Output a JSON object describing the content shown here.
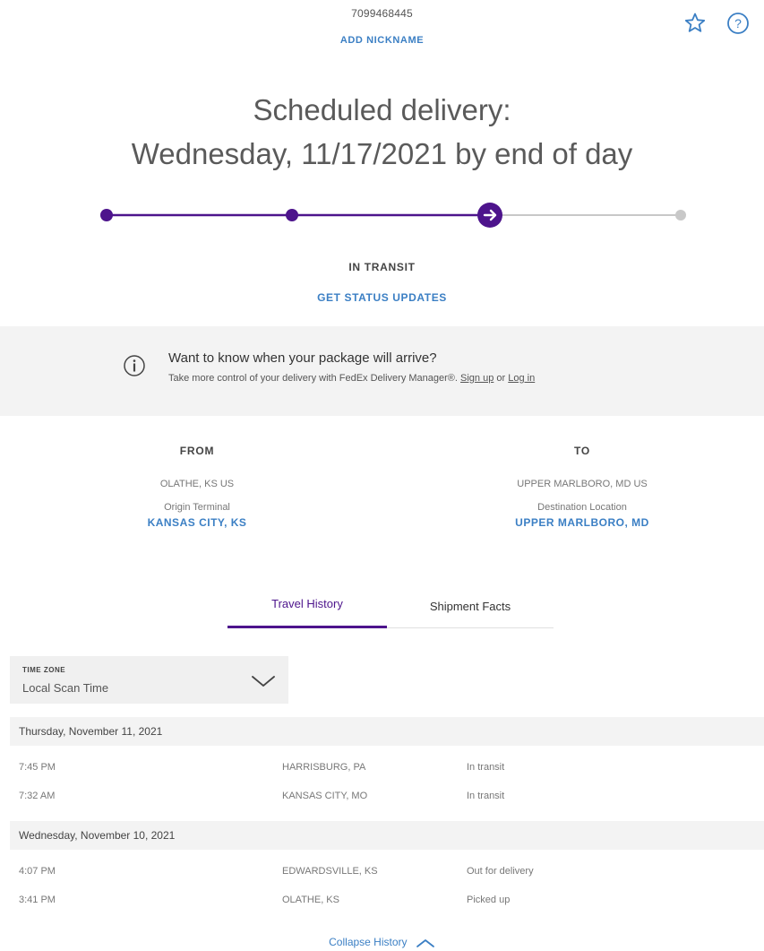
{
  "header": {
    "tracking_number": "7099468445",
    "add_nickname": "ADD NICKNAME",
    "favorite_icon": "star-icon",
    "help_icon": "question-circle-icon"
  },
  "delivery": {
    "line1": "Scheduled delivery:",
    "line2": "Wednesday, 11/17/2021 by end of day"
  },
  "progress": {
    "total_steps": 4,
    "completed_steps": 2,
    "current_step": 3,
    "current_icon": "arrow-right-icon",
    "active_color": "#4d148c",
    "inactive_color": "#c8c8c8"
  },
  "status": {
    "label": "IN TRANSIT",
    "updates_link": "GET STATUS UPDATES"
  },
  "promo": {
    "icon": "info-circle-icon",
    "title": "Want to know when your package will arrive?",
    "subtitle": "Take more control of your delivery with FedEx Delivery Manager®.",
    "signup": "Sign up",
    "or": "or",
    "login": "Log in"
  },
  "from": {
    "heading": "FROM",
    "city": "OLATHE, KS US",
    "location_type": "Origin Terminal",
    "location": "KANSAS CITY, KS"
  },
  "to": {
    "heading": "TO",
    "city": "UPPER MARLBORO, MD US",
    "location_type": "Destination Location",
    "location": "UPPER MARLBORO, MD"
  },
  "tabs": [
    {
      "label": "Travel History",
      "active": true
    },
    {
      "label": "Shipment Facts",
      "active": false
    }
  ],
  "timezone": {
    "label": "TIME ZONE",
    "value": "Local Scan Time",
    "icon": "chevron-down-icon"
  },
  "history": [
    {
      "date": "Thursday, November 11, 2021",
      "events": [
        {
          "time": "7:45 PM",
          "location": "HARRISBURG, PA",
          "status": "In transit"
        },
        {
          "time": "7:32 AM",
          "location": "KANSAS CITY, MO",
          "status": "In transit"
        }
      ]
    },
    {
      "date": "Wednesday, November 10, 2021",
      "events": [
        {
          "time": "4:07 PM",
          "location": "EDWARDSVILLE, KS",
          "status": "Out for delivery"
        },
        {
          "time": "3:41 PM",
          "location": "OLATHE, KS",
          "status": "Picked up"
        }
      ]
    }
  ],
  "collapse": {
    "label": "Collapse History",
    "icon": "chevron-up-icon"
  },
  "colors": {
    "brand_purple": "#4d148c",
    "link_blue": "#3b7fc4"
  }
}
